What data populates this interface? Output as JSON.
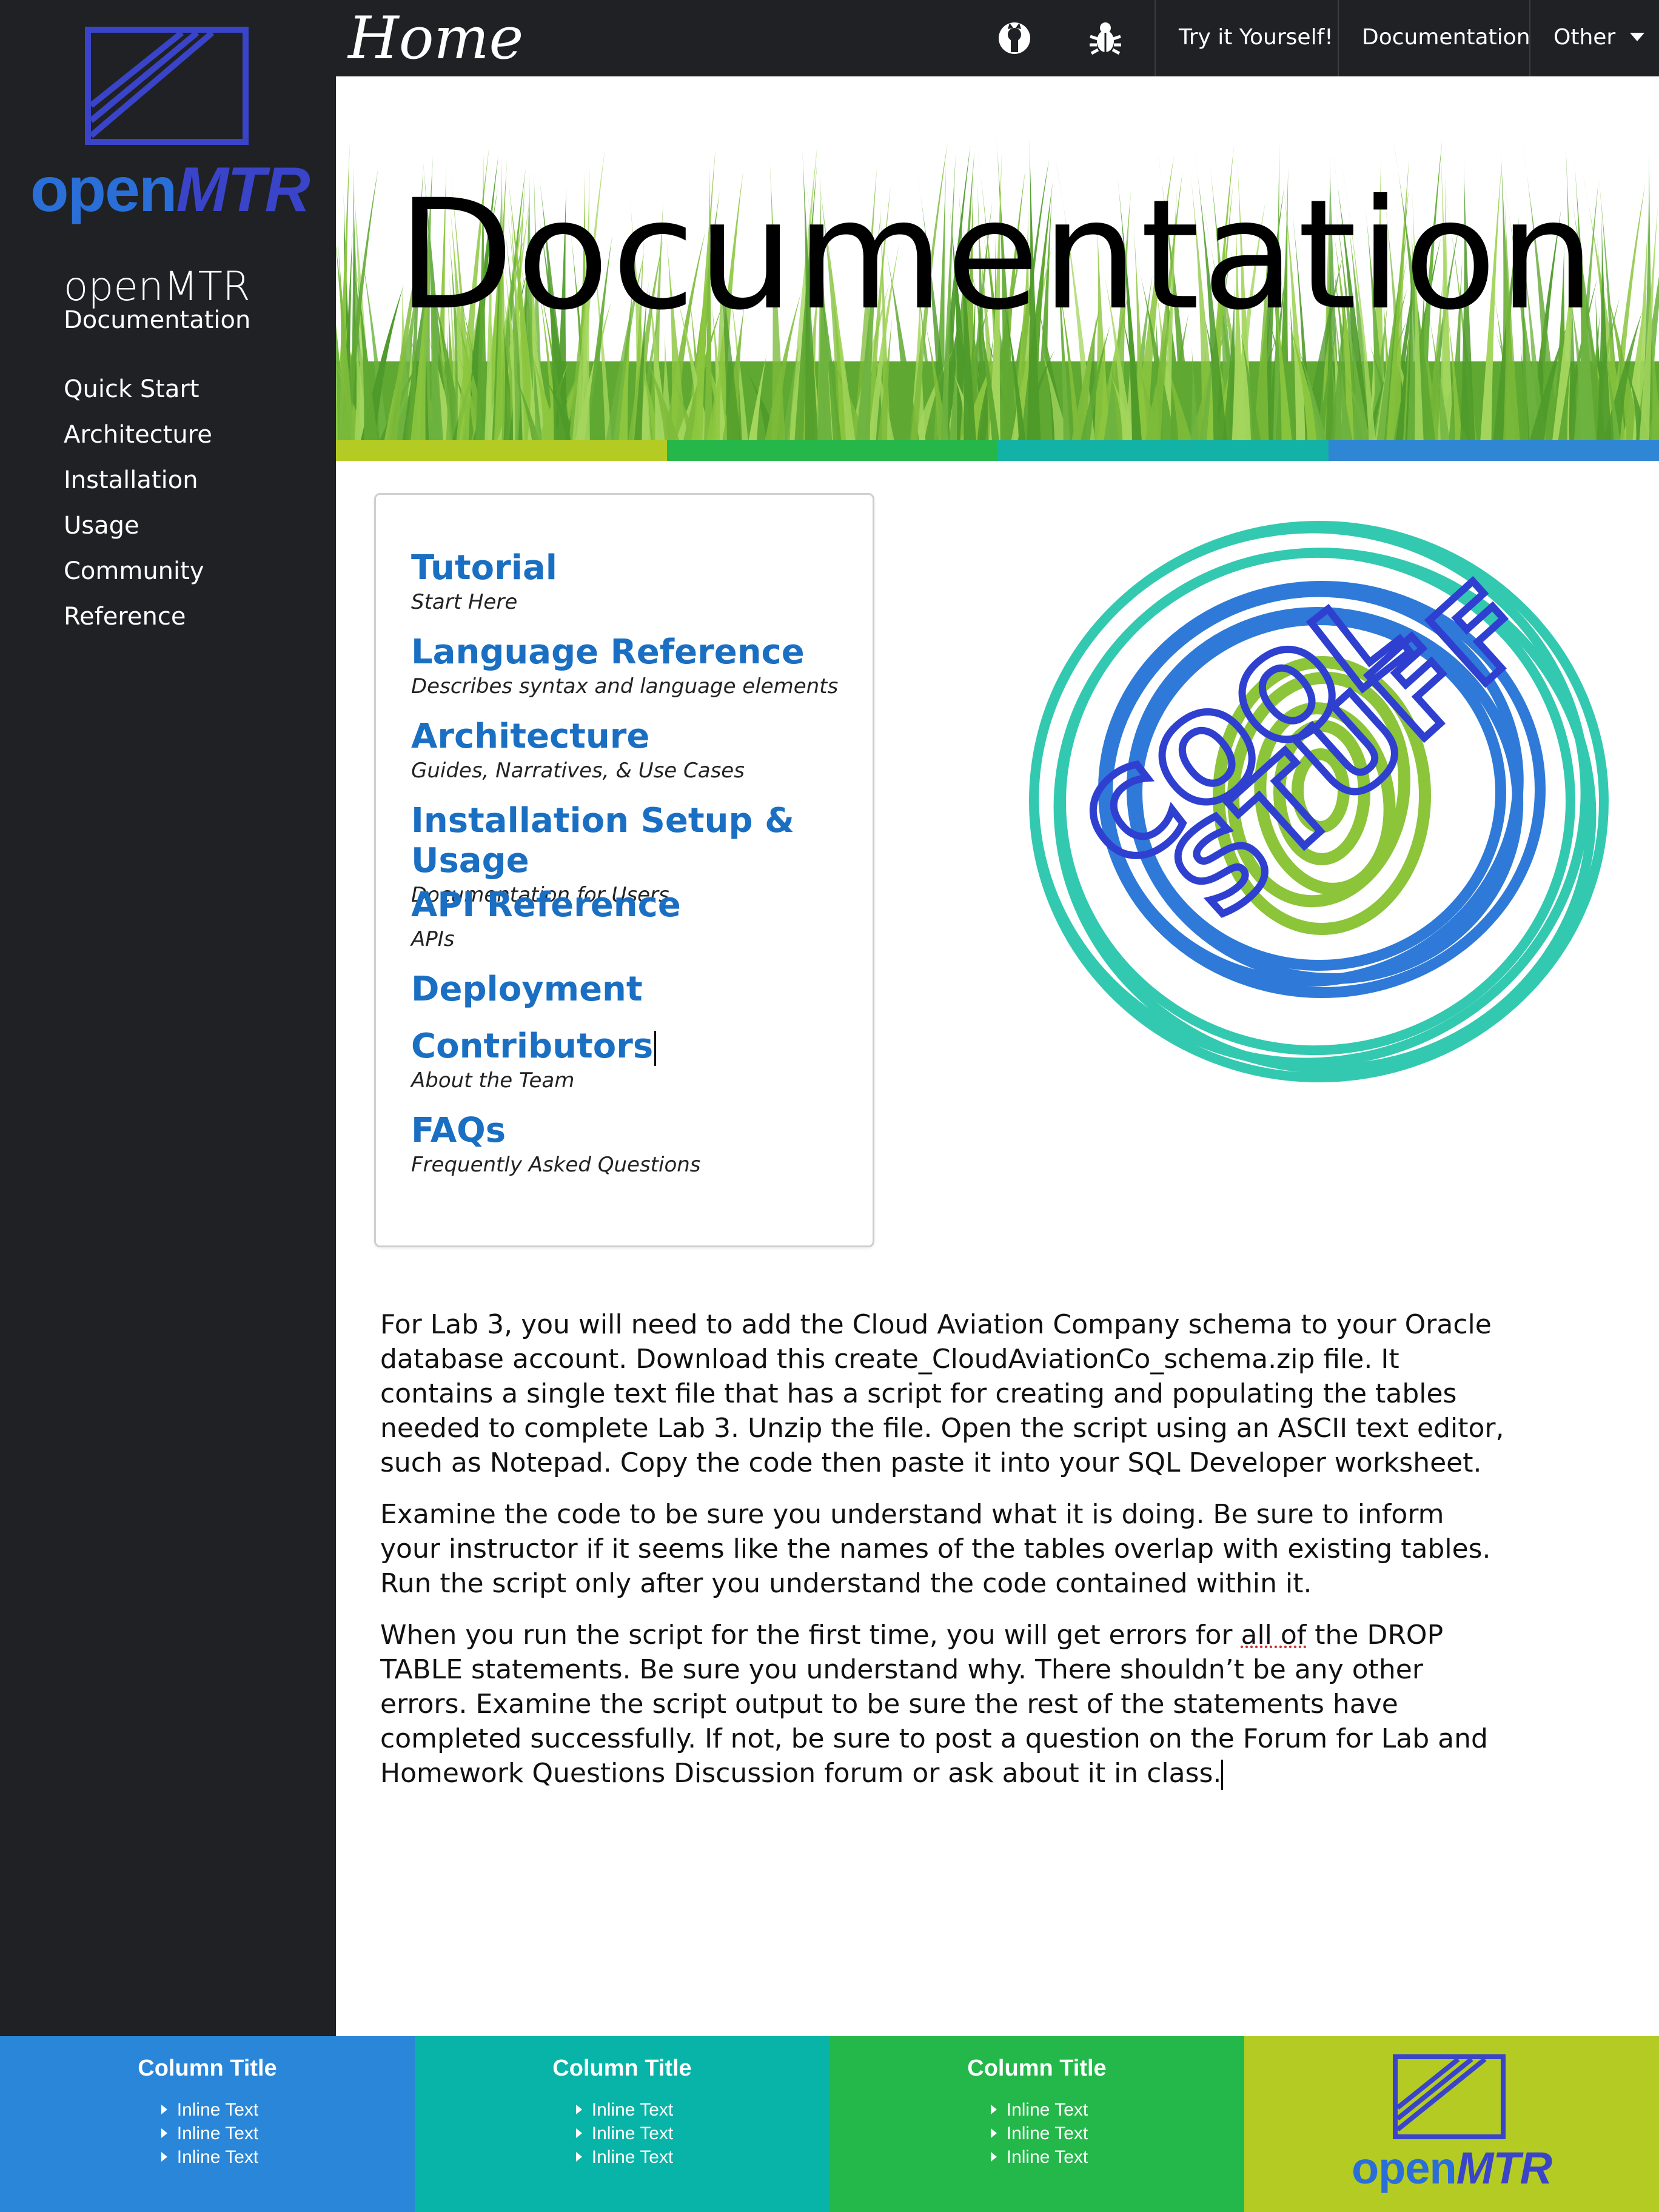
{
  "sidebar": {
    "logo": {
      "open": "open",
      "mtr": "MTR"
    },
    "title": "openMTR",
    "subtitle": "Documentation",
    "items": [
      {
        "label": "Quick Start"
      },
      {
        "label": "Architecture"
      },
      {
        "label": "Installation"
      },
      {
        "label": "Usage"
      },
      {
        "label": "Community"
      },
      {
        "label": "Reference"
      }
    ]
  },
  "topbar": {
    "home": "Home",
    "icons": [
      "github-icon",
      "bug-icon"
    ],
    "links": {
      "try": "Try it Yourself!",
      "documentation": "Documentation",
      "other": "Other"
    }
  },
  "hero": {
    "title": "Documentation",
    "strip_colors": [
      "#b4cb24",
      "#25b74a",
      "#13b2a6",
      "#2e86d4"
    ]
  },
  "docs": [
    {
      "title": "Tutorial",
      "desc": "Start Here"
    },
    {
      "title": "Language Reference",
      "desc": "Describes syntax and language elements"
    },
    {
      "title": "Architecture",
      "desc": "Guides, Narratives, & Use Cases"
    },
    {
      "title": "Installation Setup & Usage",
      "desc": "Documentation for Users"
    },
    {
      "title": "API Reference",
      "desc": "APIs"
    },
    {
      "title": "Deployment",
      "desc": ""
    },
    {
      "title": "Contributors",
      "desc": "About the Team"
    },
    {
      "title": "FAQs",
      "desc": "Frequently Asked Questions"
    }
  ],
  "cool_stuff": {
    "word1": "COOL",
    "word2": "STUFF"
  },
  "body": {
    "p1": "For Lab 3, you will need to add the Cloud Aviation Company schema to your Oracle database account. Download this create_CloudAviationCo_schema.zip file. It contains a single text file that has a script for creating and populating the tables needed to complete Lab 3. Unzip the file. Open the script using an ASCII text editor, such as Notepad. Copy the code then paste it into your SQL Developer worksheet.",
    "p2": "Examine the code to be sure you understand what it is doing. Be sure to inform your instructor if it seems like the names of the tables overlap with existing tables. Run the script only after you understand the code contained within it.",
    "p3_a": "When you run the script for the first time, you will get errors for ",
    "p3_b": "all of",
    "p3_c": " the DROP TABLE statements. Be sure you understand why. There shouldn’t be any other errors. Examine the script output to be sure the rest of the statements have completed successfully. If not, be sure to post a question on the Forum for Lab and Homework Questions Discussion forum or ask about it in class."
  },
  "footer": {
    "columns": [
      {
        "title": "Column Title",
        "items": [
          "Inline Text",
          "Inline Text",
          "Inline Text"
        ],
        "color": "#2a86d8"
      },
      {
        "title": "Column Title",
        "items": [
          "Inline Text",
          "Inline Text",
          "Inline Text"
        ],
        "color": "#08b4a8"
      },
      {
        "title": "Column Title",
        "items": [
          "Inline Text",
          "Inline Text",
          "Inline Text"
        ],
        "color": "#24b84a"
      }
    ],
    "logo": {
      "open": "open",
      "mtr": "MTR",
      "color": "#b4cb24"
    }
  }
}
